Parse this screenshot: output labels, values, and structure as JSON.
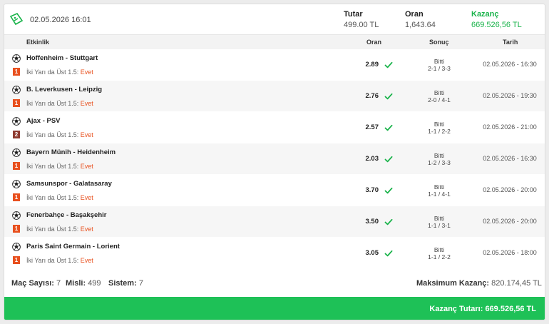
{
  "header": {
    "date": "02.05.2026 16:01",
    "stake_label": "Tutar",
    "stake_value": "499.00 TL",
    "odds_label": "Oran",
    "odds_value": "1,643.64",
    "win_label": "Kazanç",
    "win_value": "669.526,56 TL",
    "icon": "ticket-icon",
    "win_color": "#19b34a"
  },
  "table": {
    "col_event": "Etkinlik",
    "col_odds": "Oran",
    "col_result": "Sonuç",
    "col_date": "Tarih"
  },
  "rows": [
    {
      "match": "Hoffenheim - Stuttgart",
      "badge": "1",
      "market": "İki Yarı da Üst 1.5:",
      "pick": "Evet",
      "odd": "2.89",
      "status": "Bitti",
      "score": "2-1 / 3-3",
      "date": "02.05.2026 - 16:30"
    },
    {
      "match": "B. Leverkusen - Leipzig",
      "badge": "1",
      "market": "İki Yarı da Üst 1.5:",
      "pick": "Evet",
      "odd": "2.76",
      "status": "Bitti",
      "score": "2-0 / 4-1",
      "date": "02.05.2026 - 19:30"
    },
    {
      "match": "Ajax - PSV",
      "badge": "2",
      "market": "İki Yarı da Üst 1.5:",
      "pick": "Evet",
      "odd": "2.57",
      "status": "Bitti",
      "score": "1-1 / 2-2",
      "date": "02.05.2026 - 21:00"
    },
    {
      "match": "Bayern Münih - Heidenheim",
      "badge": "1",
      "market": "İki Yarı da Üst 1.5:",
      "pick": "Evet",
      "odd": "2.03",
      "status": "Bitti",
      "score": "1-2 / 3-3",
      "date": "02.05.2026 - 16:30"
    },
    {
      "match": "Samsunspor - Galatasaray",
      "badge": "1",
      "market": "İki Yarı da Üst 1.5:",
      "pick": "Evet",
      "odd": "3.70",
      "status": "Bitti",
      "score": "1-1 / 4-1",
      "date": "02.05.2026 - 20:00"
    },
    {
      "match": "Fenerbahçe - Başakşehir",
      "badge": "1",
      "market": "İki Yarı da Üst 1.5:",
      "pick": "Evet",
      "odd": "3.50",
      "status": "Bitti",
      "score": "1-1 / 3-1",
      "date": "02.05.2026 - 20:00"
    },
    {
      "match": "Paris Saint Germain - Lorient",
      "badge": "1",
      "market": "İki Yarı da Üst 1.5:",
      "pick": "Evet",
      "odd": "3.05",
      "status": "Bitti",
      "score": "1-1 / 2-2",
      "date": "02.05.2026 - 18:00"
    }
  ],
  "summary": {
    "match_count_label": "Maç Sayısı:",
    "match_count": "7",
    "misli_label": "Misli:",
    "misli": "499",
    "system_label": "Sistem:",
    "system": "7",
    "max_win_label": "Maksimum Kazanç:",
    "max_win": "820.174,45 TL"
  },
  "footer": {
    "text": "Kazanç Tutarı: 669.526,56 TL",
    "color": "#1ec157"
  }
}
